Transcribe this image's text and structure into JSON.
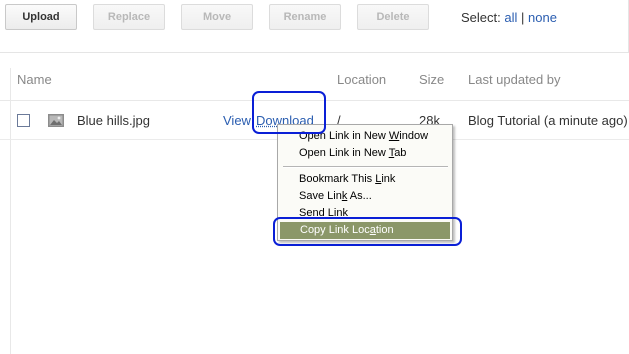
{
  "toolbar": {
    "upload": "Upload",
    "replace": "Replace",
    "move": "Move",
    "rename": "Rename",
    "delete": "Delete",
    "select_label": "Select:",
    "select_all": "all",
    "select_divider": "|",
    "select_none": "none"
  },
  "columns": {
    "name": "Name",
    "location": "Location",
    "size": "Size",
    "updated": "Last updated by"
  },
  "file": {
    "icon": "image-icon",
    "name": "Blue hills.jpg",
    "view": "View",
    "download": "Download",
    "location": "/",
    "size": "28k",
    "updated": "Blog Tutorial (a minute ago)"
  },
  "context_menu": {
    "open_window": {
      "pre": "Open Link in New ",
      "key": "W",
      "post": "indow"
    },
    "open_tab": {
      "pre": "Open Link in New ",
      "key": "T",
      "post": "ab"
    },
    "bookmark": {
      "pre": "Bookmark This ",
      "key": "L",
      "post": "ink"
    },
    "save": {
      "pre": "Save Lin",
      "key": "k",
      "post": " As..."
    },
    "send": {
      "pre": "Sen",
      "key": "d",
      "post": " Link"
    },
    "copy": {
      "pre": "Copy Link Loc",
      "key": "a",
      "post": "tion"
    }
  },
  "colors": {
    "link": "#2a5db0",
    "annotation": "#0a1fd6",
    "menu_highlight": "#8b9769"
  }
}
